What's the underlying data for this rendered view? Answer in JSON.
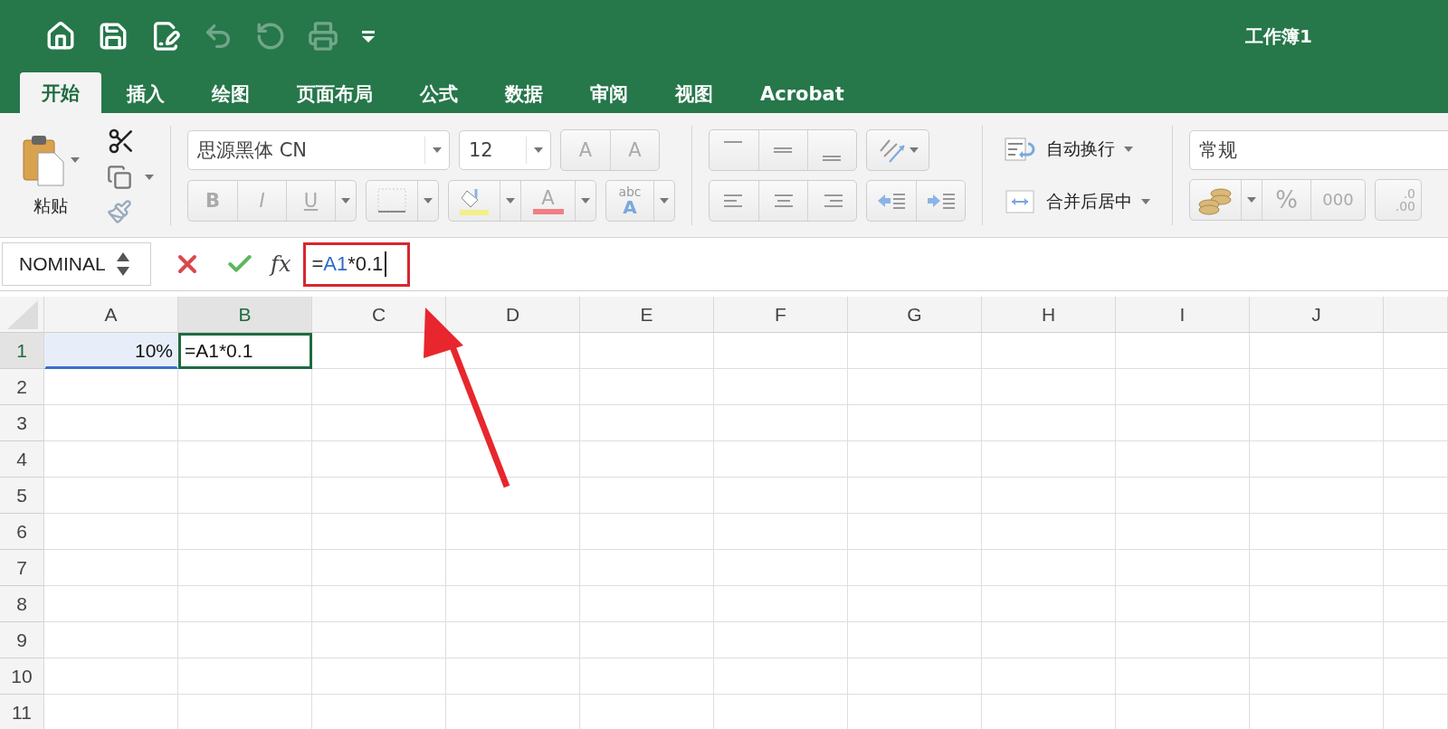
{
  "title_bar": {
    "title": "工作簿1",
    "quick_access": [
      {
        "kind": "home",
        "disabled": false
      },
      {
        "kind": "save",
        "disabled": false
      },
      {
        "kind": "edit",
        "disabled": false
      },
      {
        "kind": "undo",
        "disabled": true
      },
      {
        "kind": "redo",
        "disabled": true
      },
      {
        "kind": "print",
        "disabled": true
      },
      {
        "kind": "customize",
        "disabled": false
      }
    ]
  },
  "tabs": [
    {
      "label": "开始",
      "selected": true
    },
    {
      "label": "插入",
      "selected": false
    },
    {
      "label": "绘图",
      "selected": false
    },
    {
      "label": "页面布局",
      "selected": false
    },
    {
      "label": "公式",
      "selected": false
    },
    {
      "label": "数据",
      "selected": false
    },
    {
      "label": "审阅",
      "selected": false
    },
    {
      "label": "视图",
      "selected": false
    },
    {
      "label": "Acrobat",
      "selected": false
    }
  ],
  "ribbon": {
    "paste_label": "粘贴",
    "font_name": "思源黑体 CN",
    "font_size": "12",
    "grow_font": "A",
    "shrink_font": "A",
    "style_buttons": [
      "B",
      "I",
      "U"
    ],
    "font_color": "A",
    "text_effect": [
      "abc",
      "A"
    ],
    "wrap_text": "自动换行",
    "merge_center": "合并后居中",
    "number_format": "常规",
    "percent": "%",
    "thousands": "000",
    "decimal": [
      ".0",
      ".00"
    ]
  },
  "formula_bar": {
    "name_box": "NOMINAL",
    "fx": "fx",
    "formula_parts": [
      {
        "text": "=",
        "kind": "plain"
      },
      {
        "text": "A1",
        "kind": "reference"
      },
      {
        "text": "*0.1",
        "kind": "plain"
      }
    ],
    "editing": true
  },
  "sheet": {
    "columns": [
      {
        "label": "A",
        "selected": false
      },
      {
        "label": "B",
        "selected": true
      },
      {
        "label": "C",
        "selected": false
      },
      {
        "label": "D",
        "selected": false
      },
      {
        "label": "E",
        "selected": false
      },
      {
        "label": "F",
        "selected": false
      },
      {
        "label": "G",
        "selected": false
      },
      {
        "label": "H",
        "selected": false
      },
      {
        "label": "I",
        "selected": false
      },
      {
        "label": "J",
        "selected": false
      }
    ],
    "rows": [
      {
        "label": "1",
        "selected": true,
        "cells": [
          {
            "text": "10%",
            "kind": "reference"
          },
          {
            "text": "=A1*0.1",
            "kind": "active"
          }
        ]
      },
      {
        "label": "2",
        "selected": false
      },
      {
        "label": "3",
        "selected": false
      },
      {
        "label": "4",
        "selected": false
      },
      {
        "label": "5",
        "selected": false
      },
      {
        "label": "6",
        "selected": false
      },
      {
        "label": "7",
        "selected": false
      },
      {
        "label": "8",
        "selected": false
      },
      {
        "label": "9",
        "selected": false
      },
      {
        "label": "10",
        "selected": false
      },
      {
        "label": "11",
        "selected": false
      }
    ]
  },
  "annotations": {
    "formula_box": true,
    "arrow": true
  }
}
